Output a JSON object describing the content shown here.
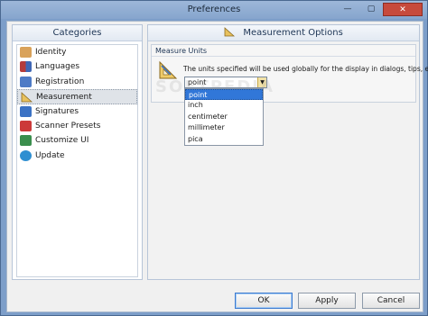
{
  "window": {
    "title": "Preferences",
    "controls": {
      "minimize": "—",
      "maximize": "▢",
      "close": "✕"
    }
  },
  "categories": {
    "header": "Categories",
    "items": [
      {
        "label": "Identity",
        "icon": "person-icon",
        "color": "#d9a25a"
      },
      {
        "label": "Languages",
        "icon": "flags-icon",
        "color": "#b53b3b"
      },
      {
        "label": "Registration",
        "icon": "user-key-icon",
        "color": "#4e7bc6"
      },
      {
        "label": "Measurement",
        "icon": "ruler-triangle-icon",
        "color": "#c59a3b"
      },
      {
        "label": "Signatures",
        "icon": "signature-icon",
        "color": "#3b72c4"
      },
      {
        "label": "Scanner Presets",
        "icon": "scanner-icon",
        "color": "#cc3a3a"
      },
      {
        "label": "Customize UI",
        "icon": "puzzle-icon",
        "color": "#3a8e4d"
      },
      {
        "label": "Update",
        "icon": "globe-icon",
        "color": "#2f8fd1"
      }
    ],
    "selected_index": 3
  },
  "measurement": {
    "header": "Measurement Options",
    "group_label": "Measure Units",
    "description": "The units specified will be used globally for the display in dialogs, tips, etc.",
    "combo_value": "point",
    "options": [
      "point",
      "inch",
      "centimeter",
      "millimeter",
      "pica"
    ],
    "highlighted_option": 0
  },
  "watermark": "SOFTPEDIA",
  "footer": {
    "ok_label": "OK",
    "apply_label": "Apply",
    "cancel_label": "Cancel"
  },
  "colors": {
    "accent": "#3177d8",
    "window_frame": "#7d9ec9"
  }
}
